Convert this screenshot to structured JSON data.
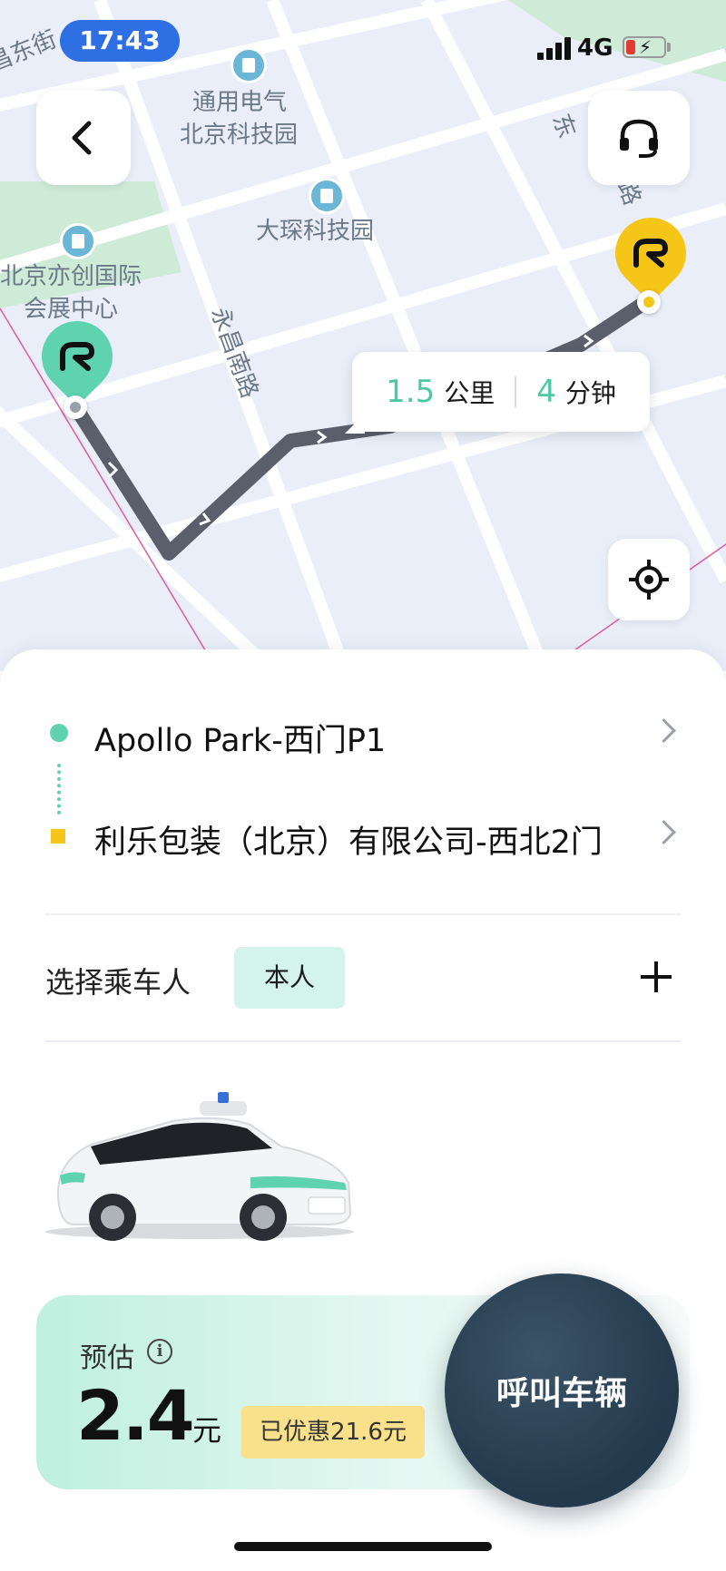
{
  "status_bar": {
    "time": "17:43",
    "network": "4G"
  },
  "map": {
    "labels": {
      "road_top_left": "昌东街",
      "poi_ge_line1": "通用电气",
      "poi_ge_line2": "北京科技园",
      "poi_dashen": "大琛科技园",
      "poi_exhibit_line1": "北京亦创国际",
      "poi_exhibit_line2": "会展中心",
      "road_yongchang": "永昌南路",
      "road_east_top": "东",
      "road_east_mid": "路"
    },
    "route_info": {
      "distance_value": "1.5",
      "distance_unit": "公里",
      "time_value": "4",
      "time_unit": "分钟"
    },
    "icons": [
      "chevron-left-icon",
      "headset-icon",
      "locate-icon",
      "building-icon"
    ]
  },
  "trip": {
    "origin": "Apollo Park-西门P1",
    "destination": "利乐包装（北京）有限公司-西北2门"
  },
  "passenger": {
    "label": "选择乘车人",
    "selected": "本人"
  },
  "estimate": {
    "label": "预估",
    "price": "2.4",
    "unit": "元",
    "discount": "已优惠21.6元"
  },
  "call_button": {
    "label": "呼叫车辆"
  },
  "colors": {
    "accent_green": "#5fd3b0",
    "accent_yellow": "#f5c518",
    "route": "#5a5f6b",
    "call_button": "#24394b"
  }
}
